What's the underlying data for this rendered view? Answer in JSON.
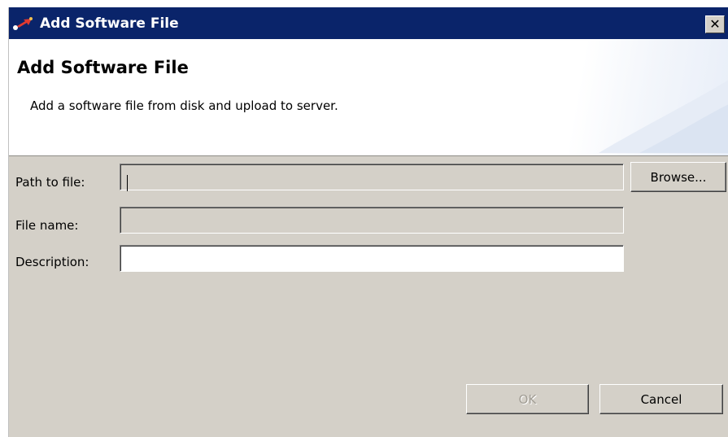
{
  "window": {
    "title": "Add Software File",
    "close_glyph": "✕",
    "icon": "software-package-icon"
  },
  "banner": {
    "title": "Add Software File",
    "description": "Add a software file from disk and upload to server."
  },
  "form": {
    "path_label": "Path to file:",
    "path_value": "",
    "name_label": "File name:",
    "name_value": "",
    "description_label": "Description:",
    "description_value": ""
  },
  "buttons": {
    "browse": "Browse...",
    "ok": "OK",
    "cancel": "Cancel"
  },
  "colors": {
    "titlebar": "#0a246a",
    "dialog_face": "#d4d0c8",
    "banner_background": "#ffffff"
  }
}
